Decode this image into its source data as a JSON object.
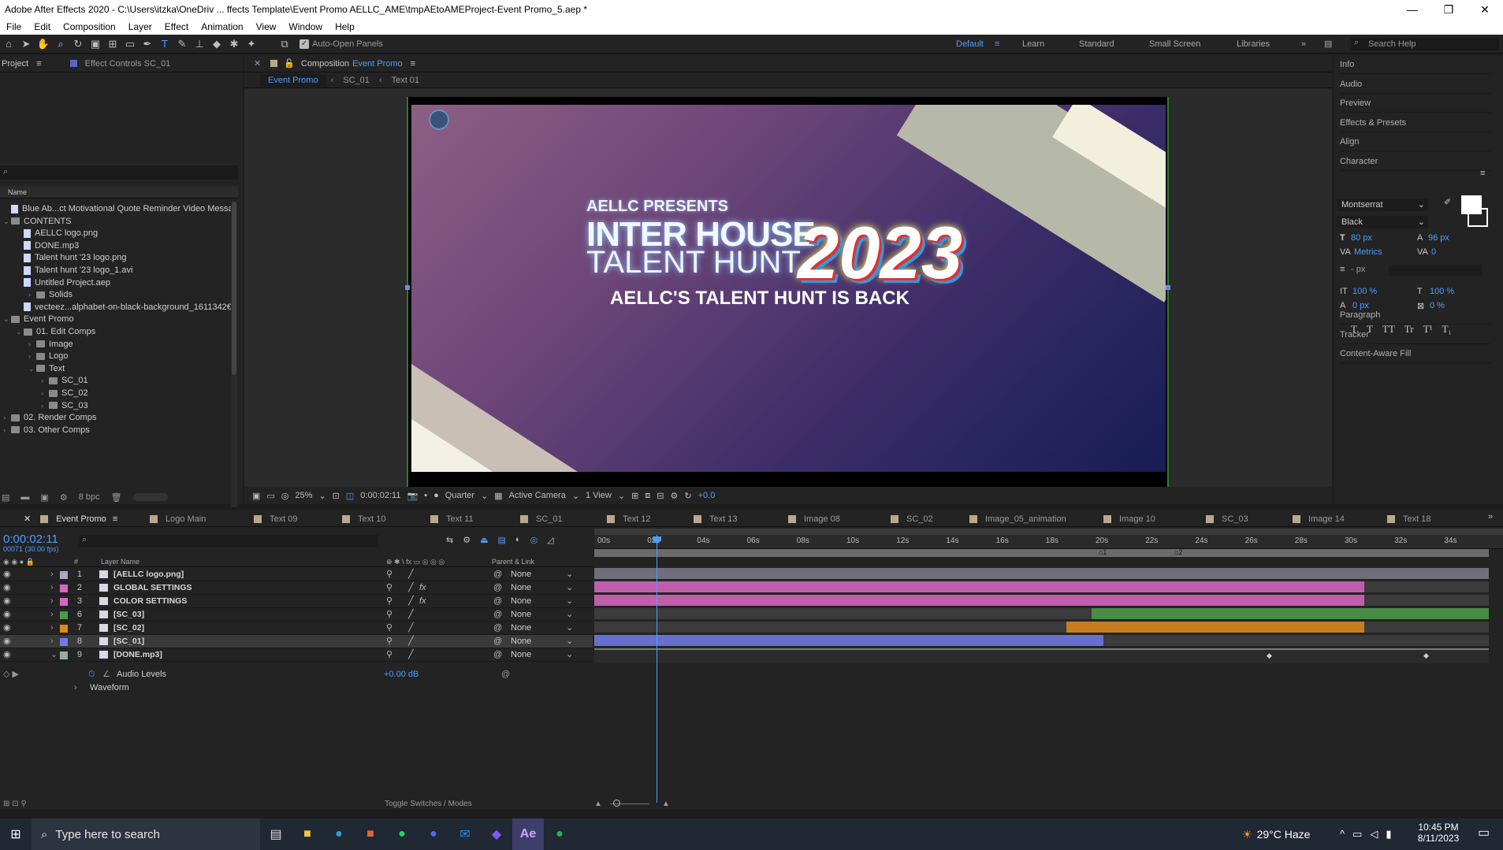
{
  "window": {
    "title": "Adobe After Effects 2020 - C:\\Users\\itzka\\OneDriv ... ffects Template\\Event Promo AELLC_AME\\tmpAEtoAMEProject-Event Promo_5.aep *"
  },
  "menu": [
    "File",
    "Edit",
    "Composition",
    "Layer",
    "Effect",
    "Animation",
    "View",
    "Window",
    "Help"
  ],
  "toolbar": {
    "auto_open": "Auto-Open Panels",
    "workspaces": [
      "Default",
      "Learn",
      "Standard",
      "Small Screen",
      "Libraries"
    ],
    "search_placeholder": "Search Help"
  },
  "project": {
    "tab_project": "Project",
    "tab_effect": "Effect Controls SC_01",
    "col_name": "Name",
    "bpc": "8 bpc",
    "items": [
      {
        "label": "Blue Ab...ct Motivational Quote Reminder Video Messa",
        "kind": "comp",
        "depth": 0
      },
      {
        "label": "CONTENTS",
        "kind": "folder",
        "depth": 0,
        "open": true
      },
      {
        "label": "AELLC logo.png",
        "kind": "file",
        "depth": 1
      },
      {
        "label": "DONE.mp3",
        "kind": "audio",
        "depth": 1
      },
      {
        "label": "Talent hunt '23 logo.png",
        "kind": "file",
        "depth": 1
      },
      {
        "label": "Talent hunt '23 logo_1.avi",
        "kind": "file",
        "depth": 1
      },
      {
        "label": "Untitled Project.aep",
        "kind": "file",
        "depth": 1,
        "open": true
      },
      {
        "label": "Solids",
        "kind": "folder",
        "depth": 2
      },
      {
        "label": "vecteez...alphabet-on-black-background_1611342€",
        "kind": "file",
        "depth": 1
      },
      {
        "label": "Event Promo",
        "kind": "folder",
        "depth": 0,
        "open": true
      },
      {
        "label": "01. Edit Comps",
        "kind": "folder",
        "depth": 1,
        "open": true
      },
      {
        "label": "Image",
        "kind": "folder",
        "depth": 2
      },
      {
        "label": "Logo",
        "kind": "folder",
        "depth": 2
      },
      {
        "label": "Text",
        "kind": "folder",
        "depth": 2,
        "open": true
      },
      {
        "label": "SC_01",
        "kind": "folder",
        "depth": 3
      },
      {
        "label": "SC_02",
        "kind": "folder",
        "depth": 3
      },
      {
        "label": "SC_03",
        "kind": "folder",
        "depth": 3
      },
      {
        "label": "02. Render Comps",
        "kind": "folder",
        "depth": 0
      },
      {
        "label": "03. Other Comps",
        "kind": "folder",
        "depth": 0
      }
    ]
  },
  "composition": {
    "tab": "Composition",
    "name": "Event Promo",
    "breadcrumbs": [
      "Event Promo",
      "SC_01",
      "Text 01"
    ],
    "canvas": {
      "line1": "AELLC PRESENTS",
      "line2": "INTER HOUSE",
      "line3": "TALENT HUNT",
      "year": "2023",
      "line4": "AELLC'S TALENT HUNT IS BACK"
    },
    "footer": {
      "zoom": "25%",
      "timecode": "0:00:02:11",
      "resolution": "Quarter",
      "camera": "Active Camera",
      "view": "1 View",
      "exposure": "+0.0"
    }
  },
  "right_panels": {
    "items": [
      "Info",
      "Audio",
      "Preview",
      "Effects & Presets",
      "Align",
      "Character"
    ],
    "character": {
      "font": "Montserrat",
      "style": "Black",
      "size": "80 px",
      "leading": "96 px",
      "kerning": "Metrics",
      "tracking": "0",
      "stroke": "- px",
      "vscale": "100 %",
      "hscale": "100 %",
      "baseline": "0 px",
      "tsume": "0 %",
      "styles": [
        "T",
        "T",
        "TT",
        "Tr",
        "T¹",
        "T₁"
      ]
    },
    "after": [
      "Paragraph",
      "Tracker",
      "Content-Aware Fill"
    ]
  },
  "timeline": {
    "tabs": [
      "Event Promo",
      "Logo Main",
      "Text 09",
      "Text 10",
      "Text 11",
      "SC_01",
      "Text 12",
      "Text 13",
      "Image 08",
      "SC_02",
      "Image_05_animation",
      "Image 10",
      "SC_03",
      "Image 14",
      "Text 18"
    ],
    "timecode": "0:00:02:11",
    "fps": "00071 (30.00 fps)",
    "col_layer": "Layer Name",
    "col_parent": "Parent & Link",
    "ruler": [
      "00s",
      "02s",
      "04s",
      "06s",
      "08s",
      "10s",
      "12s",
      "14s",
      "16s",
      "18s",
      "20s",
      "22s",
      "24s",
      "26s",
      "28s",
      "30s",
      "32s",
      "34s"
    ],
    "layers": [
      {
        "num": "1",
        "name": "[AELLC logo.png]",
        "color": "#a9a7c6",
        "parent": "None",
        "fx": false
      },
      {
        "num": "2",
        "name": "GLOBAL SETTINGS",
        "color": "#d766c1",
        "parent": "None",
        "fx": true
      },
      {
        "num": "3",
        "name": "COLOR SETTINGS",
        "color": "#d766c1",
        "parent": "None",
        "fx": true
      },
      {
        "num": "6",
        "name": "[SC_03]",
        "color": "#4b9a44",
        "parent": "None",
        "fx": false
      },
      {
        "num": "7",
        "name": "[SC_02]",
        "color": "#e08a1b",
        "parent": "None",
        "fx": false
      },
      {
        "num": "8",
        "name": "[SC_01]",
        "color": "#6e7be8",
        "parent": "None",
        "fx": false
      },
      {
        "num": "9",
        "name": "[DONE.mp3]",
        "color": "#9aab9a",
        "parent": "None",
        "fx": false
      }
    ],
    "sub": {
      "prop": "Audio Levels",
      "value": "+0.00 dB",
      "waveform": "Waveform"
    },
    "toggle": "Toggle Switches / Modes"
  },
  "taskbar": {
    "search": "Type here to search",
    "weather": "29°C Haze",
    "time": "10:45 PM",
    "date": "8/11/2023"
  }
}
